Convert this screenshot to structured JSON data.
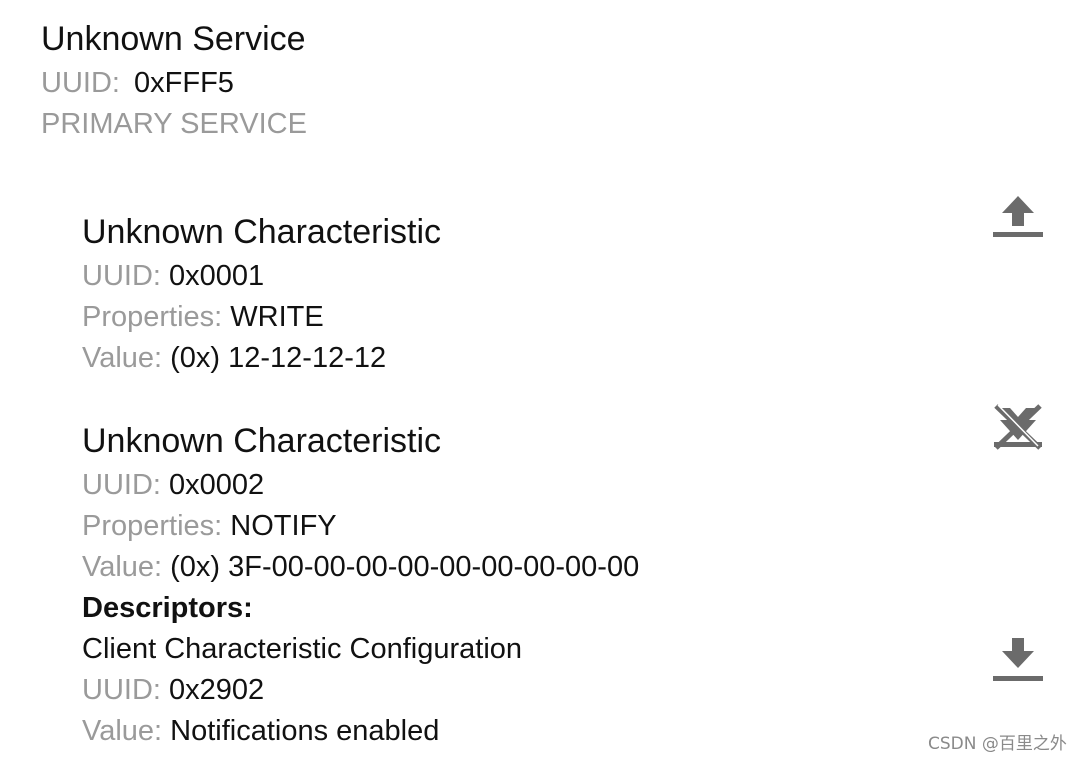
{
  "service": {
    "title": "Unknown Service",
    "uuid_label": "UUID:",
    "uuid_value": "0xFFF5",
    "type": "PRIMARY SERVICE"
  },
  "characteristics": [
    {
      "title": "Unknown Characteristic",
      "uuid_label": "UUID:",
      "uuid_value": "0x0001",
      "properties_label": "Properties:",
      "properties_value": "WRITE",
      "value_label": "Value:",
      "value_value": "(0x) 12-12-12-12",
      "action_icon": "upload-icon"
    },
    {
      "title": "Unknown Characteristic",
      "uuid_label": "UUID:",
      "uuid_value": "0x0002",
      "properties_label": "Properties:",
      "properties_value": "NOTIFY",
      "value_label": "Value:",
      "value_value": "(0x) 3F-00-00-00-00-00-00-00-00-00",
      "action_icon": "notifications-disable-icon",
      "descriptors": {
        "heading": "Descriptors:",
        "items": [
          {
            "name": "Client Characteristic Configuration",
            "uuid_label": "UUID:",
            "uuid_value": "0x2902",
            "value_label": "Value:",
            "value_value": "Notifications enabled",
            "action_icon": "download-icon"
          }
        ]
      }
    }
  ],
  "watermark": "CSDN @百里之外",
  "colors": {
    "label_gray": "#9a9a9a",
    "text_dark": "#111111",
    "icon_gray": "#6b6b6b"
  }
}
